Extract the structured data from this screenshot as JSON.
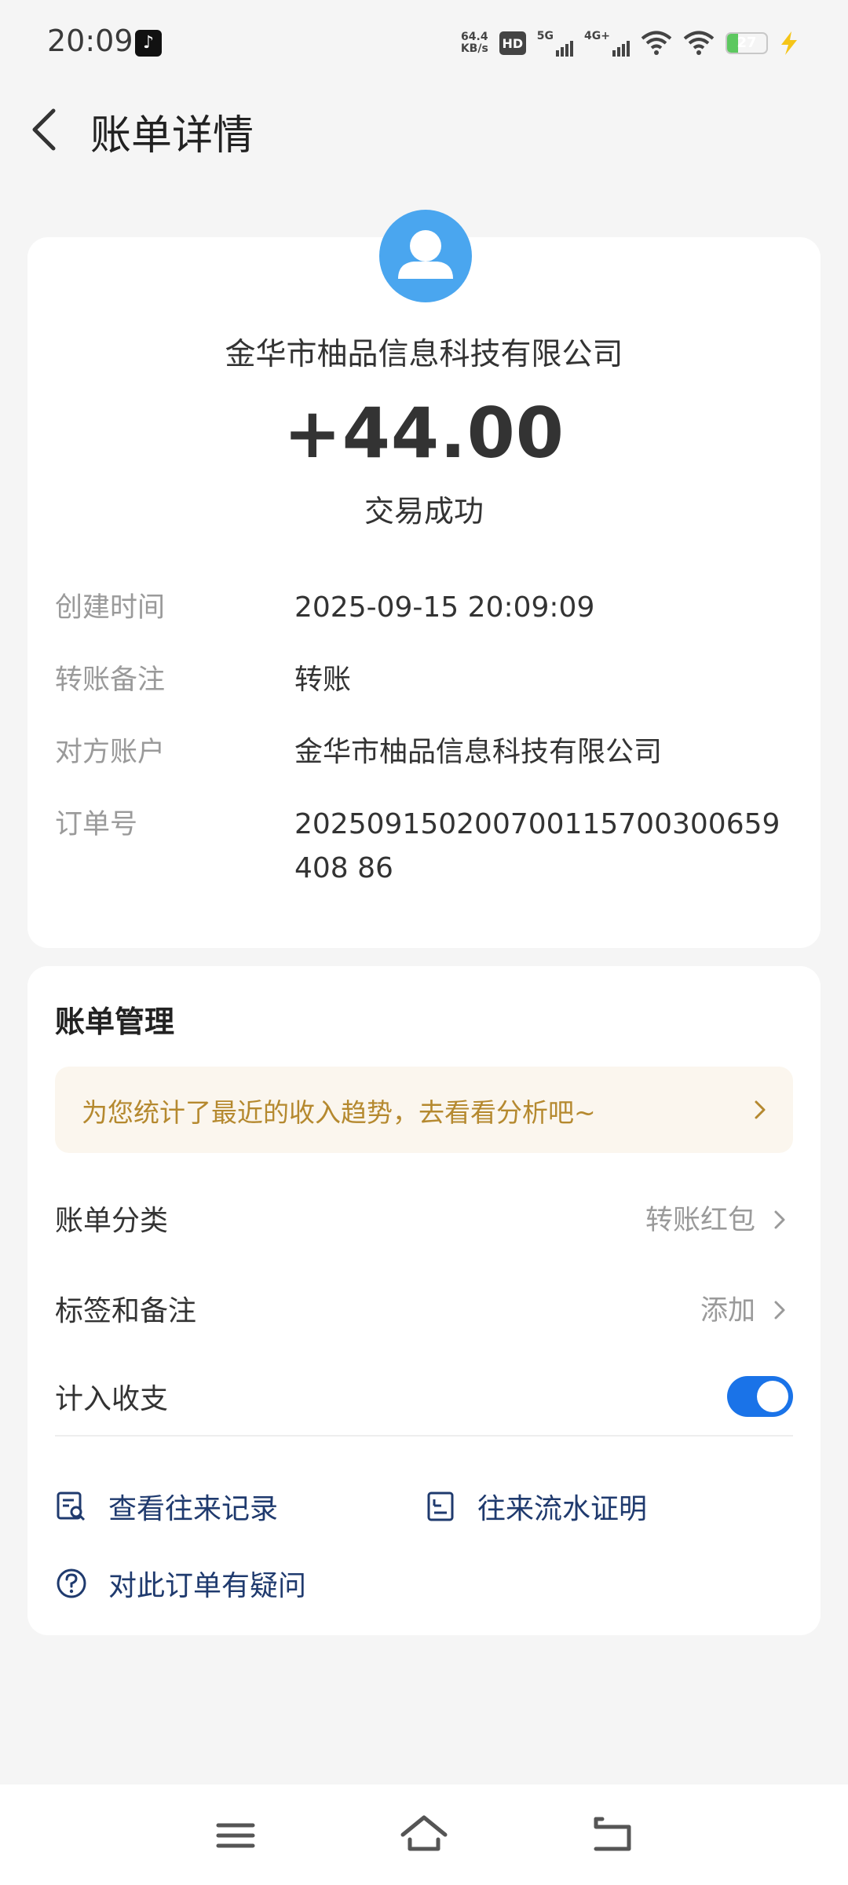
{
  "status_bar": {
    "time": "20:09",
    "app_icon": "tiktok-icon",
    "net_speed_value": "64.4",
    "net_speed_unit": "KB/s",
    "hd_label": "HD",
    "sim1_label": "5G",
    "sim2_label": "4G+",
    "battery_level": "27",
    "battery_fraction": 0.27
  },
  "header": {
    "title": "账单详情",
    "back_icon": "chevron-left-icon"
  },
  "transaction": {
    "avatar_icon": "user-avatar-icon",
    "merchant": "金华市柚品信息科技有限公司",
    "amount": "+44.00",
    "status": "交易成功"
  },
  "details": [
    {
      "label": "创建时间",
      "value": "2025-09-15 20:09:09"
    },
    {
      "label": "转账备注",
      "value": "转账"
    },
    {
      "label": "对方账户",
      "value": "金华市柚品信息科技有限公司"
    },
    {
      "label": "订单号",
      "value": "202509150200700115700300659408 86"
    }
  ],
  "management": {
    "title": "账单管理",
    "tip": "为您统计了最近的收入趋势，去看看分析吧~",
    "rows": [
      {
        "label": "账单分类",
        "value": "转账红包"
      },
      {
        "label": "标签和备注",
        "value": "添加"
      },
      {
        "label": "计入收支",
        "toggle_on": true
      }
    ],
    "links": [
      {
        "label": "查看往来记录",
        "icon": "record-search-icon"
      },
      {
        "label": "往来流水证明",
        "icon": "document-certificate-icon"
      },
      {
        "label": "对此订单有疑问",
        "icon": "question-circle-icon"
      }
    ]
  },
  "nav": {
    "menu_icon": "menu-icon",
    "home_icon": "home-icon",
    "back_icon": "back-arrow-icon"
  },
  "colors": {
    "accent": "#1a73e8",
    "avatar_bg": "#4aa6ef",
    "tip_text": "#b5892f",
    "tip_bg": "#fbf6ee",
    "link_text": "#1f3a6e",
    "battery_fill": "#5cc85f"
  }
}
